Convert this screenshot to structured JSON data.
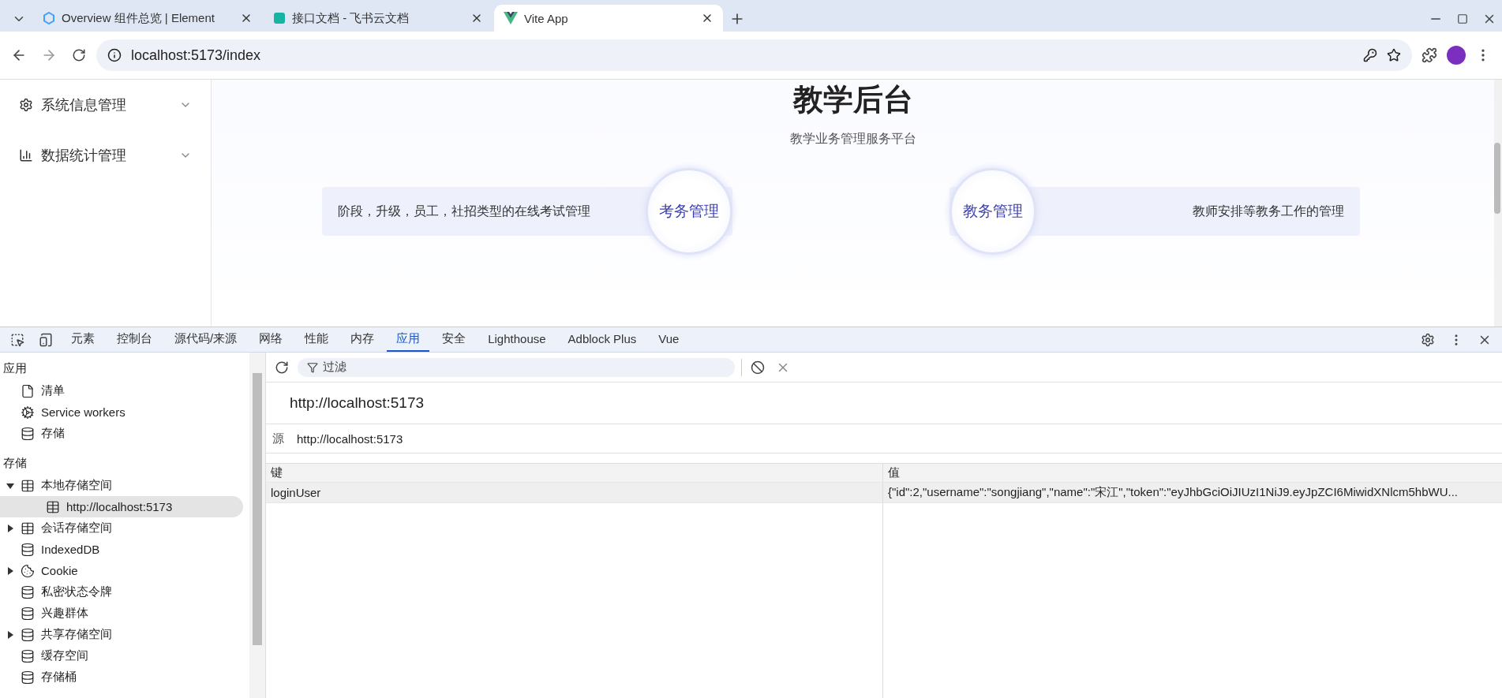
{
  "browser": {
    "tabs": [
      {
        "title": "Overview 组件总览 | Element",
        "kind": "element",
        "selected": false
      },
      {
        "title": "接口文档 - 飞书云文档",
        "kind": "docs",
        "selected": false
      },
      {
        "title": "Vite App",
        "kind": "vue",
        "selected": true
      }
    ],
    "url": "localhost:5173/index"
  },
  "page": {
    "sidebar": [
      {
        "label": "系统信息管理",
        "kind": "settings"
      },
      {
        "label": "数据统计管理",
        "kind": "chart"
      }
    ],
    "title": "教学后台",
    "subtitle": "教学业务管理服务平台",
    "cards": [
      {
        "title": "考务管理",
        "description": "阶段，升级，员工，社招类型的在线考试管理"
      },
      {
        "title": "教务管理",
        "description": "教师安排等教务工作的管理"
      }
    ]
  },
  "devtools": {
    "tabs": [
      {
        "label": "元素",
        "selected": false
      },
      {
        "label": "控制台",
        "selected": false
      },
      {
        "label": "源代码/来源",
        "selected": false
      },
      {
        "label": "网络",
        "selected": false
      },
      {
        "label": "性能",
        "selected": false
      },
      {
        "label": "内存",
        "selected": false
      },
      {
        "label": "应用",
        "selected": true
      },
      {
        "label": "安全",
        "selected": false
      },
      {
        "label": "Lighthouse",
        "selected": false
      },
      {
        "label": "Adblock Plus",
        "selected": false
      },
      {
        "label": "Vue",
        "selected": false
      }
    ],
    "sections": [
      {
        "heading": "应用",
        "items": [
          {
            "label": "清单",
            "kind": "file",
            "selected": false
          },
          {
            "label": "Service workers",
            "kind": "gear",
            "selected": false
          },
          {
            "label": "存储",
            "kind": "database",
            "selected": false
          }
        ]
      },
      {
        "heading": "存储",
        "items": [
          {
            "label": "本地存储空间",
            "kind": "table",
            "expanded": true,
            "selected": false,
            "children": [
              {
                "label": "http://localhost:5173",
                "kind": "table",
                "selected": true
              }
            ]
          },
          {
            "label": "会话存储空间",
            "kind": "table",
            "expanded": false,
            "selected": false
          },
          {
            "label": "IndexedDB",
            "kind": "database",
            "selected": false
          },
          {
            "label": "Cookie",
            "kind": "cookie",
            "expanded": false,
            "selected": false
          },
          {
            "label": "私密状态令牌",
            "kind": "database",
            "selected": false
          },
          {
            "label": "兴趣群体",
            "kind": "database",
            "selected": false
          },
          {
            "label": "共享存储空间",
            "kind": "database",
            "expanded": false,
            "selected": false
          },
          {
            "label": "缓存空间",
            "kind": "database",
            "selected": false
          },
          {
            "label": "存储桶",
            "kind": "database",
            "selected": false
          }
        ]
      }
    ],
    "filter": {
      "placeholder": "过滤"
    },
    "origin_title": "http://localhost:5173",
    "source": {
      "label": "源",
      "value": "http://localhost:5173"
    },
    "table": {
      "columns": [
        "键",
        "值"
      ],
      "rows": [
        {
          "key": "loginUser",
          "value": "{\"id\":2,\"username\":\"songjiang\",\"name\":\"宋江\",\"token\":\"eyJhbGciOiJIUzI1NiJ9.eyJpZCI6MiwidXNlcm5hbWU...",
          "selected": true
        }
      ]
    }
  }
}
